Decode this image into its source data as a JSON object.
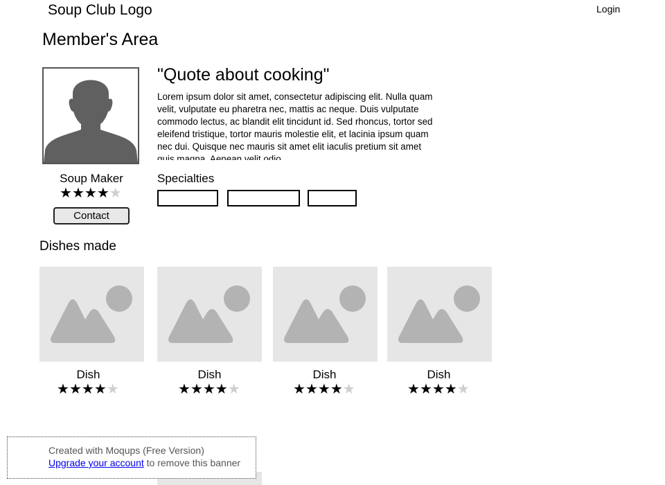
{
  "header": {
    "logo": "Soup Club Logo",
    "login": "Login"
  },
  "page": {
    "title": "Member's Area"
  },
  "profile": {
    "quote": "\"Quote about cooking\"",
    "bio": "Lorem ipsum dolor sit amet, consectetur adipiscing elit. Nulla quam velit, vulputate eu pharetra nec, mattis ac neque. Duis vulputate commodo lectus, ac blandit elit tincidunt id. Sed rhoncus, tortor sed eleifend tristique, tortor mauris molestie elit, et lacinia ipsum quam nec dui. Quisque nec mauris sit amet elit iaculis pretium sit amet quis magna. Aenean velit odio",
    "name": "Soup Maker",
    "rating": 4,
    "rating_max": 5,
    "contact_label": "Contact",
    "avatar_icon": "person-silhouette-icon"
  },
  "specialties": {
    "title": "Specialties",
    "tags": [
      "",
      "",
      ""
    ]
  },
  "dishes": {
    "title": "Dishes made",
    "items": [
      {
        "name": "Dish",
        "rating": 4,
        "icon": "image-placeholder-icon"
      },
      {
        "name": "Dish",
        "rating": 4,
        "icon": "image-placeholder-icon"
      },
      {
        "name": "Dish",
        "rating": 4,
        "icon": "image-placeholder-icon"
      },
      {
        "name": "Dish",
        "rating": 4,
        "icon": "image-placeholder-icon"
      }
    ]
  },
  "banner": {
    "line1": "Created with Moqups (Free Version)",
    "link": "Upgrade your account",
    "tail": " to remove this banner"
  },
  "colors": {
    "placeholder_bg": "#e6e6e6",
    "placeholder_fg": "#b3b3b3",
    "avatar": "#606060",
    "star_off": "#cfcfcf"
  }
}
